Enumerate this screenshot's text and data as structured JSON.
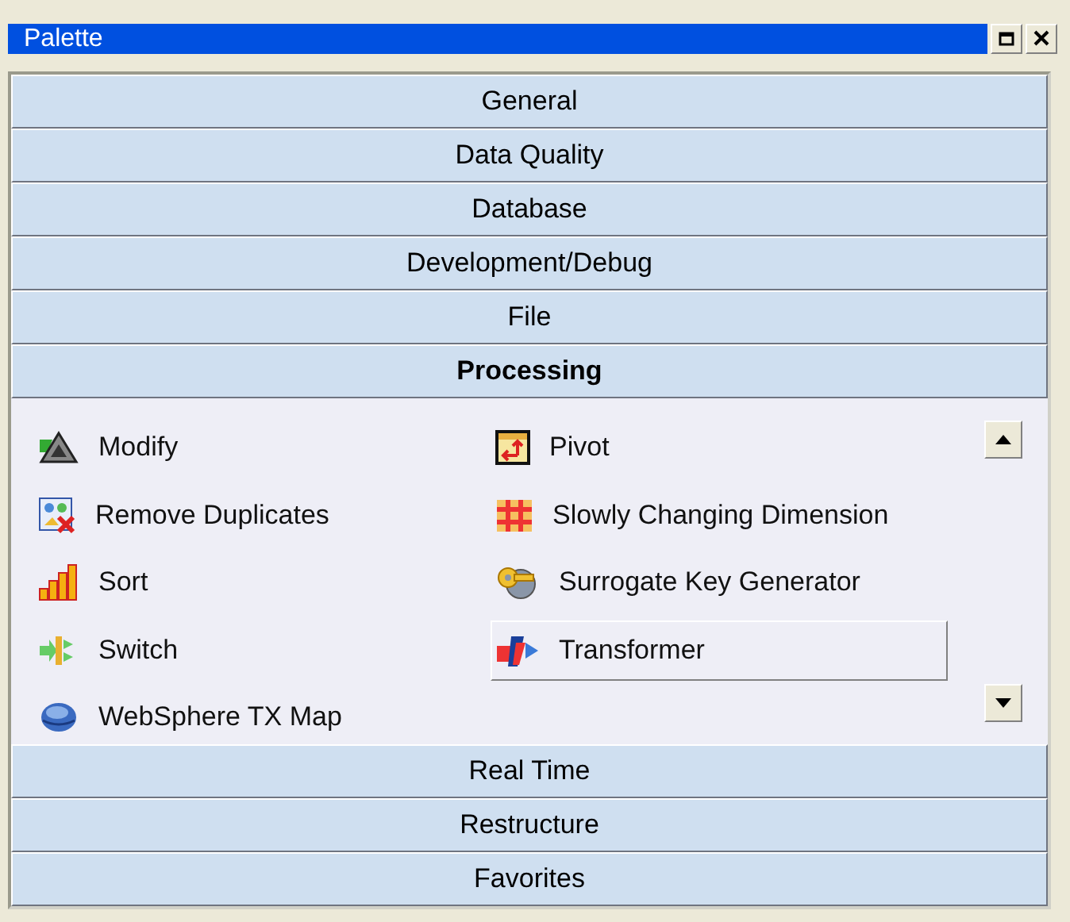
{
  "window": {
    "title": "Palette"
  },
  "groups": [
    {
      "label": "General",
      "expanded": false
    },
    {
      "label": "Data Quality",
      "expanded": false
    },
    {
      "label": "Database",
      "expanded": false
    },
    {
      "label": "Development/Debug",
      "expanded": false
    },
    {
      "label": "File",
      "expanded": false
    },
    {
      "label": "Processing",
      "expanded": true,
      "items": [
        {
          "label": "Modify",
          "hovered": false
        },
        {
          "label": "Pivot",
          "hovered": false
        },
        {
          "label": "Remove Duplicates",
          "hovered": false
        },
        {
          "label": "Slowly Changing Dimension",
          "hovered": false
        },
        {
          "label": "Sort",
          "hovered": false
        },
        {
          "label": "Surrogate Key Generator",
          "hovered": false
        },
        {
          "label": "Switch",
          "hovered": false
        },
        {
          "label": "Transformer",
          "hovered": true
        },
        {
          "label": "WebSphere TX Map",
          "hovered": false
        }
      ]
    },
    {
      "label": "Real Time",
      "expanded": false
    },
    {
      "label": "Restructure",
      "expanded": false
    },
    {
      "label": "Favorites",
      "expanded": false
    }
  ]
}
